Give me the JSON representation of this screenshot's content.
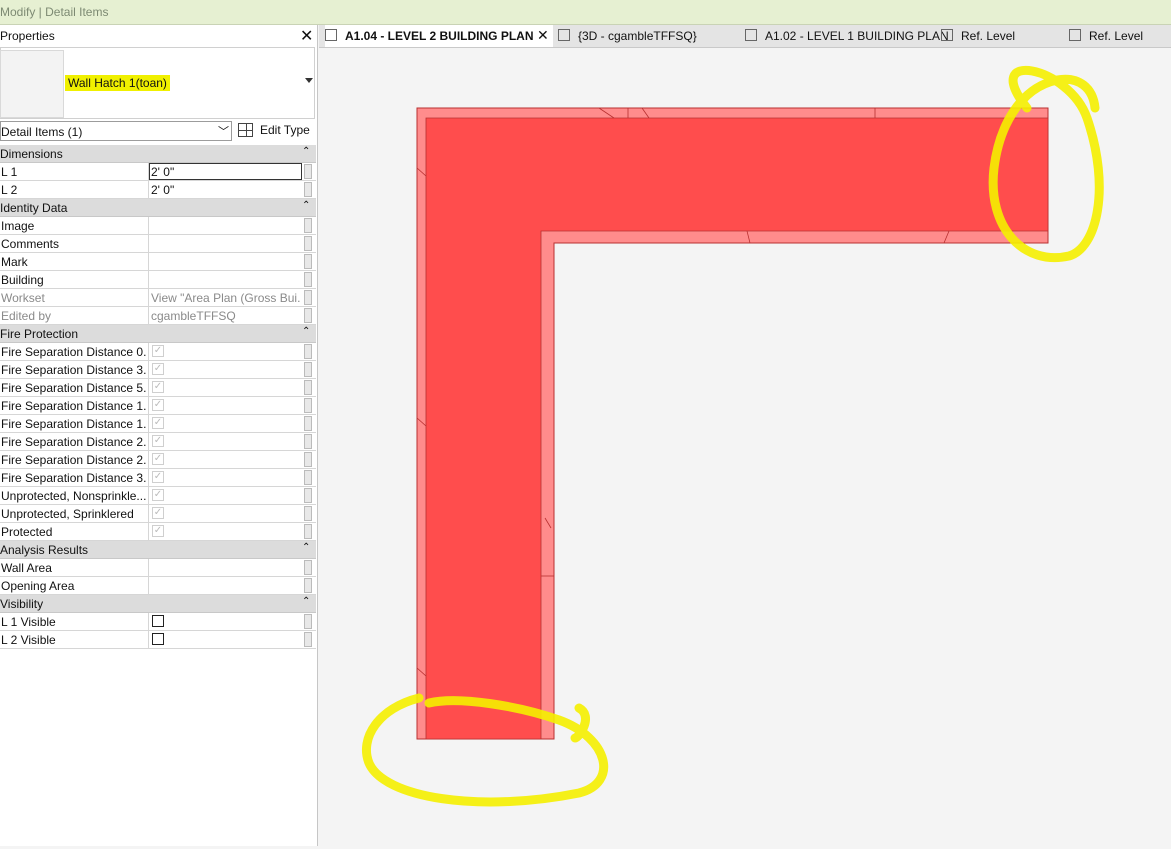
{
  "topbar": {
    "context": "Modify | Detail Items"
  },
  "properties": {
    "title": "Properties",
    "type_name": "Wall Hatch 1(toan)",
    "filter_label": "Detail Items (1)",
    "edit_type_label": "Edit Type",
    "groups": [
      {
        "name": "Dimensions",
        "rows": [
          {
            "name": "L 1",
            "value": "2'  0\"",
            "editing": true
          },
          {
            "name": "L 2",
            "value": "2'  0\""
          }
        ]
      },
      {
        "name": "Identity Data",
        "rows": [
          {
            "name": "Image",
            "value": ""
          },
          {
            "name": "Comments",
            "value": ""
          },
          {
            "name": "Mark",
            "value": ""
          },
          {
            "name": "Building",
            "value": ""
          },
          {
            "name": "Workset",
            "value": "View \"Area Plan (Gross Bui...",
            "disabled": true
          },
          {
            "name": "Edited by",
            "value": "cgambleTFFSQ",
            "disabled": true
          }
        ]
      },
      {
        "name": "Fire Protection",
        "rows": [
          {
            "name": "Fire Separation Distance 0...",
            "check": "disabled"
          },
          {
            "name": "Fire Separation Distance 3...",
            "check": "disabled"
          },
          {
            "name": "Fire Separation Distance 5...",
            "check": "disabled"
          },
          {
            "name": "Fire Separation Distance 1...",
            "check": "disabled"
          },
          {
            "name": "Fire Separation Distance 1...",
            "check": "disabled"
          },
          {
            "name": "Fire Separation Distance 2...",
            "check": "disabled"
          },
          {
            "name": "Fire Separation Distance 2...",
            "check": "disabled"
          },
          {
            "name": "Fire Separation Distance 3...",
            "check": "disabled"
          },
          {
            "name": "Unprotected, Nonsprinkle...",
            "check": "disabled"
          },
          {
            "name": "Unprotected, Sprinklered",
            "check": "disabled"
          },
          {
            "name": "Protected",
            "check": "disabled"
          }
        ]
      },
      {
        "name": "Analysis Results",
        "rows": [
          {
            "name": "Wall Area",
            "value": ""
          },
          {
            "name": "Opening Area",
            "value": ""
          }
        ]
      },
      {
        "name": "Visibility",
        "rows": [
          {
            "name": "L 1 Visible",
            "check": "off"
          },
          {
            "name": "L 2 Visible",
            "check": "off"
          }
        ]
      }
    ]
  },
  "tabs": [
    {
      "label": "A1.04 - LEVEL 2 BUILDING PLAN",
      "active": true,
      "icon": "floor-plan-icon"
    },
    {
      "label": "{3D - cgambleTFFSQ}",
      "icon": "3d-view-icon"
    },
    {
      "label": "A1.02 - LEVEL 1 BUILDING PLAN",
      "icon": "floor-plan-icon"
    },
    {
      "label": "Ref. Level",
      "icon": "floor-plan-icon"
    },
    {
      "label": "Ref. Level",
      "icon": "floor-plan-icon"
    }
  ],
  "colors": {
    "hatch_fill": "#ff4d4d",
    "hatch_edge": "#ff8c8c",
    "markup": "#f5f000",
    "highlight": "#f0f000"
  }
}
